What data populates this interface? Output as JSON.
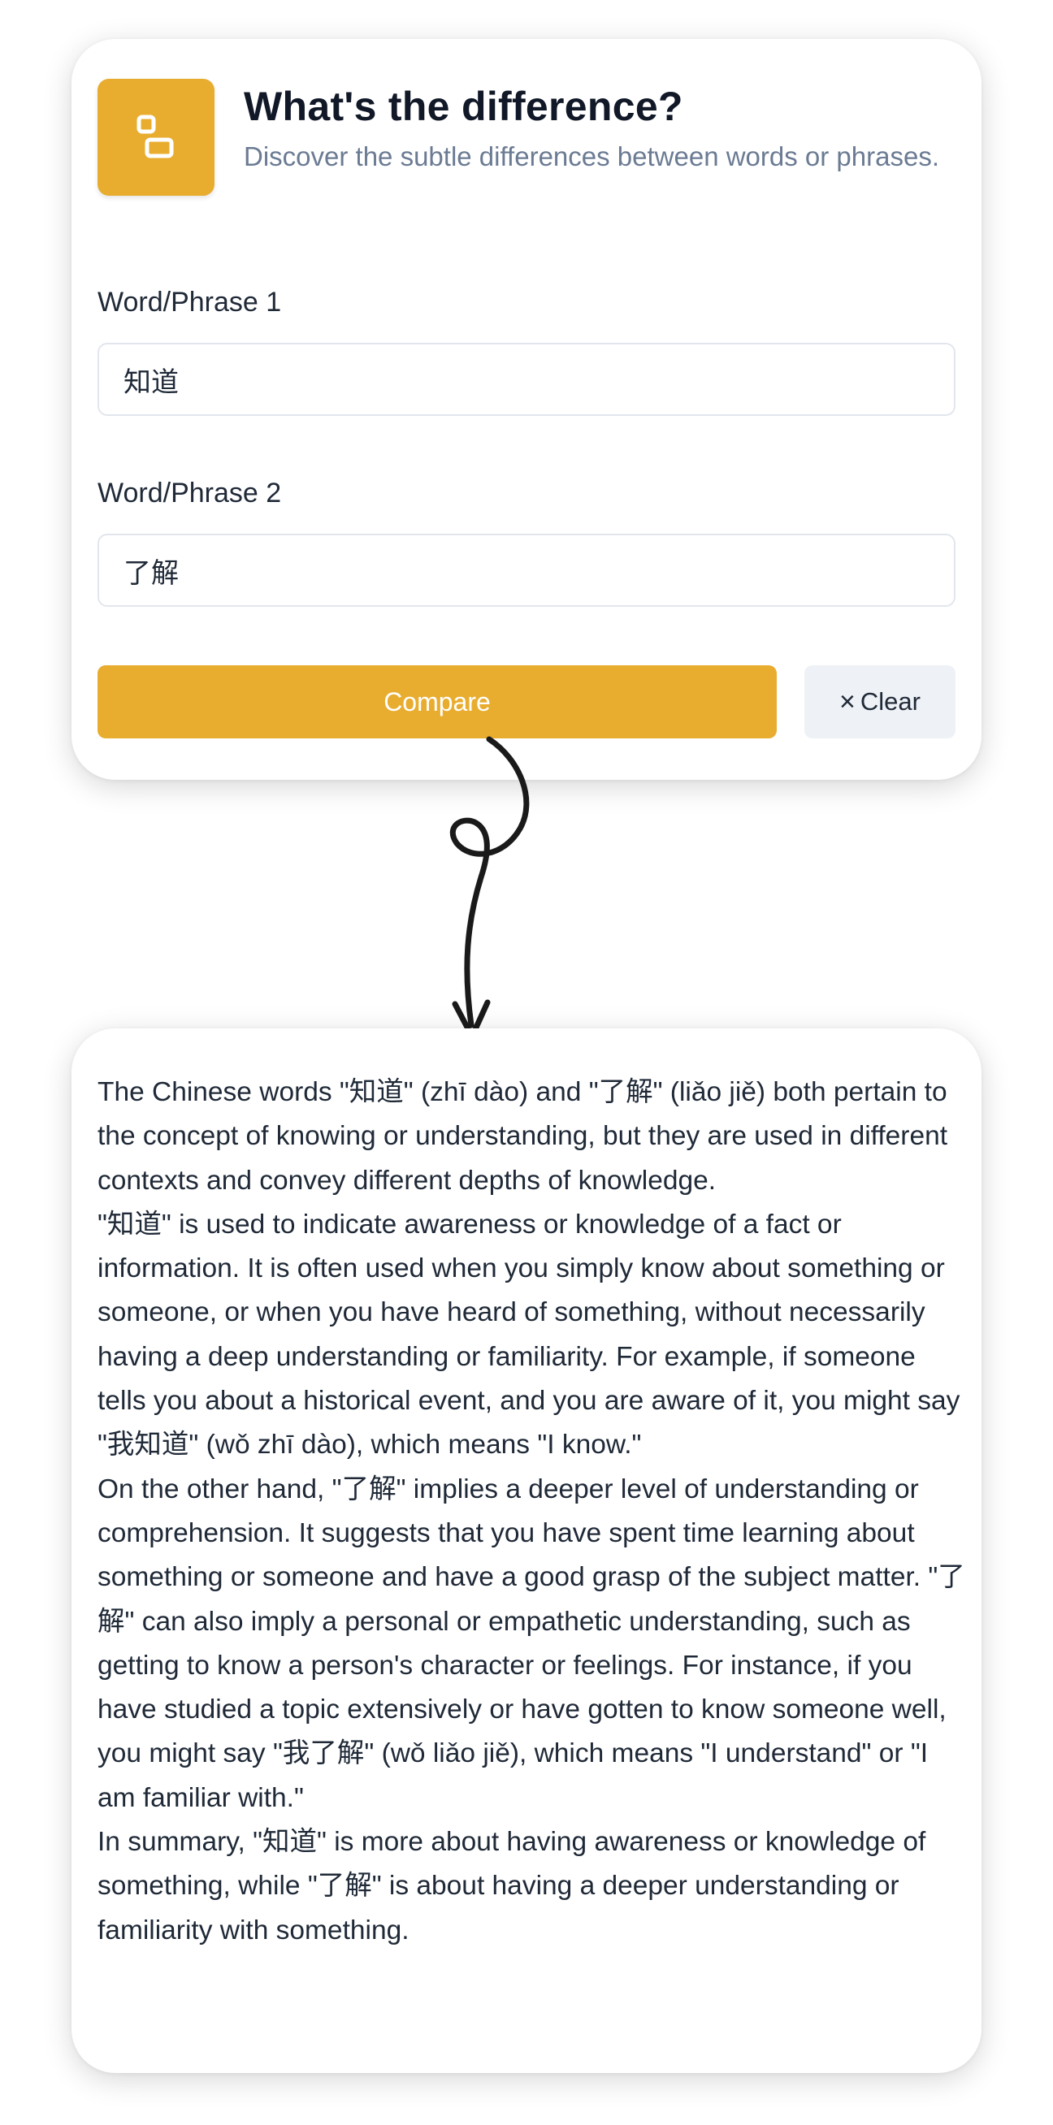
{
  "header": {
    "title": "What's the difference?",
    "subtitle": "Discover the subtle differences between words or phrases.",
    "logo_icon": "two-boxes-icon",
    "accent_color": "#e8ad2f"
  },
  "form": {
    "word1_label": "Word/Phrase 1",
    "word1_value": "知道",
    "word2_label": "Word/Phrase 2",
    "word2_value": "了解",
    "compare_label": "Compare",
    "clear_icon": "×",
    "clear_label": "Clear"
  },
  "result": {
    "paragraphs": [
      "The Chinese words \"知道\" (zhī dào) and \"了解\" (liǎo jiě) both pertain to the concept of knowing or understanding, but they are used in different contexts and convey different depths of knowledge.",
      "\"知道\" is used to indicate awareness or knowledge of a fact or information. It is often used when you simply know about something or someone, or when you have heard of something, without necessarily having a deep understanding or familiarity. For example, if someone tells you about a historical event, and you are aware of it, you might say \"我知道\" (wǒ zhī dào), which means \"I know.\"",
      "On the other hand, \"了解\" implies a deeper level of understanding or comprehension. It suggests that you have spent time learning about something or someone and have a good grasp of the subject matter. \"了解\" can also imply a personal or empathetic understanding, such as getting to know a person's character or feelings. For instance, if you have studied a topic extensively or have gotten to know someone well, you might say \"我了解\" (wǒ liǎo jiě), which means \"I understand\" or \"I am familiar with.\"",
      "In summary, \"知道\" is more about having awareness or knowledge of something, while \"了解\" is about having a deeper understanding or familiarity with something."
    ]
  }
}
